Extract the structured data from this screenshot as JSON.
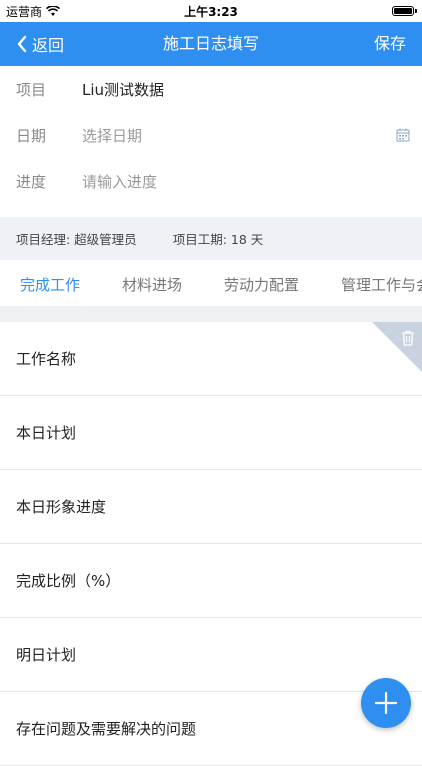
{
  "status_bar": {
    "carrier": "运营商",
    "time": "上午3:23"
  },
  "nav": {
    "back_label": "返回",
    "title": "施工日志填写",
    "save_label": "保存"
  },
  "form": {
    "project_label": "项目",
    "project_value": "Liu测试数据",
    "date_label": "日期",
    "date_placeholder": "选择日期",
    "progress_label": "进度",
    "progress_placeholder": "请输入进度"
  },
  "info": {
    "manager": "项目经理: 超级管理员",
    "duration": "项目工期: 18 天"
  },
  "tabs": [
    {
      "label": "完成工作",
      "active": true
    },
    {
      "label": "材料进场",
      "active": false
    },
    {
      "label": "劳动力配置",
      "active": false
    },
    {
      "label": "管理工作与会",
      "active": false
    }
  ],
  "card_rows": [
    {
      "label": "工作名称"
    },
    {
      "label": "本日计划"
    },
    {
      "label": "本日形象进度"
    },
    {
      "label": "完成比例（%）"
    },
    {
      "label": "明日计划"
    },
    {
      "label": "存在问题及需要解决的问题"
    }
  ],
  "colors": {
    "accent": "#2f8ff0",
    "info_band": "#eef2f7",
    "corner": "#c8d3df"
  },
  "icons": {
    "back": "chevron-left-icon",
    "calendar": "calendar-icon",
    "trash": "trash-icon",
    "add": "plus-icon",
    "wifi": "wifi-icon",
    "battery": "battery-icon"
  }
}
